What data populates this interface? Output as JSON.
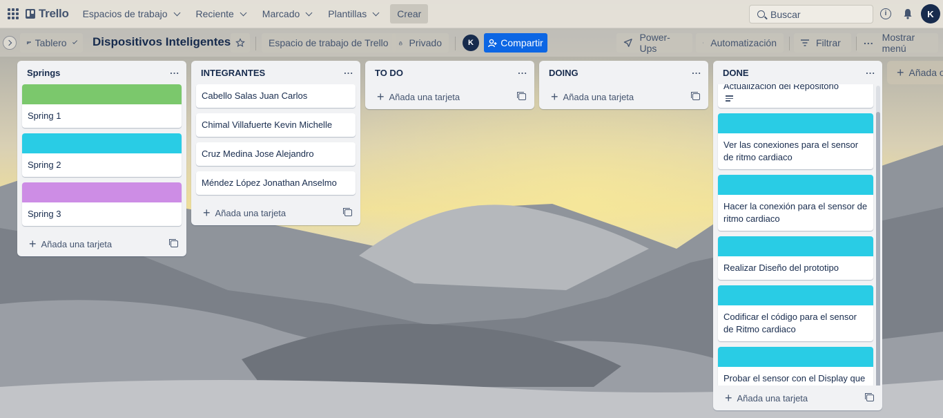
{
  "topbar": {
    "brand": "Trello",
    "nav": [
      "Espacios de trabajo",
      "Reciente",
      "Marcado",
      "Plantillas"
    ],
    "create": "Crear",
    "search_placeholder": "Buscar",
    "avatar": "K"
  },
  "board": {
    "view": "Tablero",
    "title": "Dispositivos Inteligentes",
    "workspace": "Espacio de trabajo de Trello",
    "visibility": "Privado",
    "member_avatar": "K",
    "share": "Compartir",
    "powerups": "Power-Ups",
    "automation": "Automatización",
    "filter": "Filtrar",
    "menu": "Mostrar menú"
  },
  "add_card": "Añada una tarjeta",
  "add_list": "Añada otra lista",
  "colors": {
    "green": "#7bc86c",
    "cyan": "#29cce5",
    "purple": "#cd8de5",
    "share": "#0c66e4"
  },
  "lists": [
    {
      "title": "Springs",
      "cards": [
        {
          "text": "Spring 1",
          "cover": "#7bc86c"
        },
        {
          "text": "Spring 2",
          "cover": "#29cce5"
        },
        {
          "text": "Spring 3",
          "cover": "#cd8de5"
        }
      ]
    },
    {
      "title": "INTEGRANTES",
      "cards": [
        {
          "text": "Cabello Salas Juan Carlos"
        },
        {
          "text": "Chimal Villafuerte Kevin Michelle"
        },
        {
          "text": "Cruz Medina Jose Alejandro"
        },
        {
          "text": "Méndez López Jonathan Anselmo"
        }
      ]
    },
    {
      "title": "TO DO",
      "cards": []
    },
    {
      "title": "DOING",
      "cards": []
    },
    {
      "title": "DONE",
      "cards": [
        {
          "text": "Actualización del Repositorio",
          "has_description": true
        },
        {
          "text": "Ver las conexiones para el sensor de ritmo cardiaco",
          "cover": "#29cce5"
        },
        {
          "text": "Hacer la conexión para el sensor de ritmo cardiaco",
          "cover": "#29cce5"
        },
        {
          "text": "Realizar Diseño del prototipo",
          "cover": "#29cce5"
        },
        {
          "text": "Codificar el código para el sensor de Ritmo cardiaco",
          "cover": "#29cce5"
        },
        {
          "text": "Probar el sensor con el Display que funcione bien",
          "cover": "#29cce5"
        }
      ]
    }
  ]
}
